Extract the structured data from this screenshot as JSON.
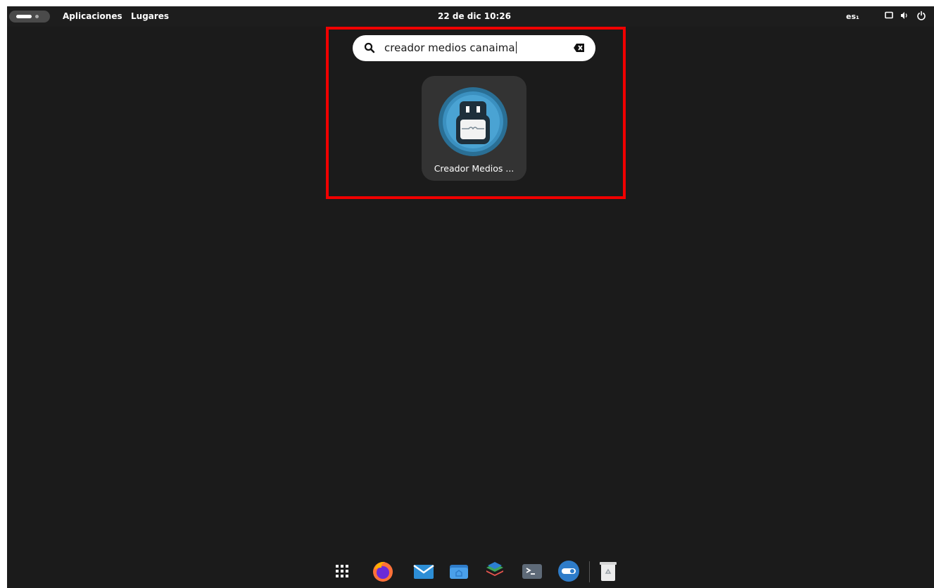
{
  "topbar": {
    "activities_label": "",
    "menu_apps": "Aplicaciones",
    "menu_places": "Lugares",
    "clock": "22 de dic  10:26",
    "lang": "es₁",
    "tray_icons": [
      "display-icon",
      "volume-icon",
      "power-icon"
    ]
  },
  "search": {
    "value": "creador medios canaima",
    "icon": "search-icon",
    "clear_icon": "clear-text-icon"
  },
  "results": [
    {
      "label": "Creador Medios ...",
      "icon": "usb-drive-icon"
    }
  ],
  "highlight_color": "#f00000",
  "dash": {
    "items": [
      "app-grid-icon",
      "firefox-icon",
      "mail-icon",
      "files-icon",
      "layers-icon",
      "terminal-icon",
      "toggle-icon",
      "trash-icon"
    ]
  }
}
